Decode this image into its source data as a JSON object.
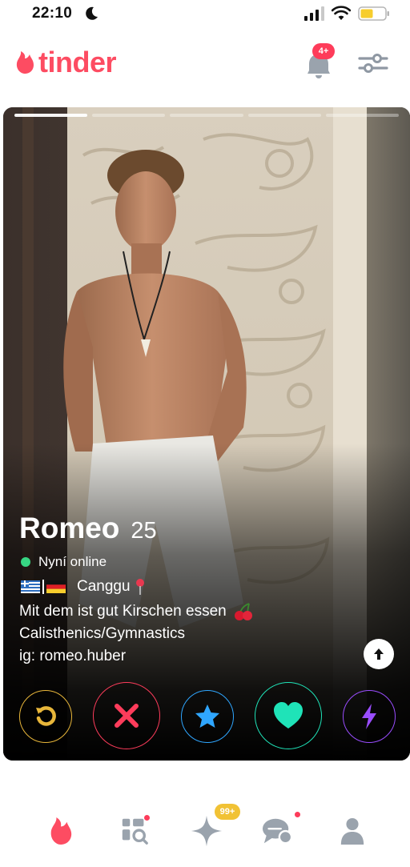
{
  "status_bar": {
    "time": "22:10",
    "icons": [
      "moon-icon",
      "signal-icon",
      "wifi-icon",
      "battery-icon"
    ]
  },
  "header": {
    "logo_text": "tinder",
    "notifications_badge": "4+",
    "brand_color": "#fd4c62"
  },
  "card": {
    "photo_index": 1,
    "photo_count": 5,
    "name": "Romeo",
    "age": "25",
    "online_status": "Nyní online",
    "location": "Canggu",
    "flags": [
      "greece-flag-icon",
      "germany-flag-icon"
    ],
    "bio_lines": [
      "Mit dem ist gut Kirschen essen",
      "Calisthenics/Gymnastics",
      "ig: romeo.huber"
    ]
  },
  "actions": [
    {
      "name": "rewind",
      "icon": "rewind-icon",
      "color": "#e8b63a"
    },
    {
      "name": "nope",
      "icon": "close-icon",
      "color": "#fd3c5b"
    },
    {
      "name": "super-like",
      "icon": "star-icon",
      "color": "#2fa6ff"
    },
    {
      "name": "like",
      "icon": "heart-icon",
      "color": "#1fe3b8"
    },
    {
      "name": "boost",
      "icon": "lightning-icon",
      "color": "#9a4dff"
    }
  ],
  "bottom_nav": {
    "items": [
      "flame-icon",
      "explore-icon",
      "gold-sparkle-icon",
      "chat-icon",
      "profile-icon"
    ],
    "gold_badge": "99+"
  }
}
